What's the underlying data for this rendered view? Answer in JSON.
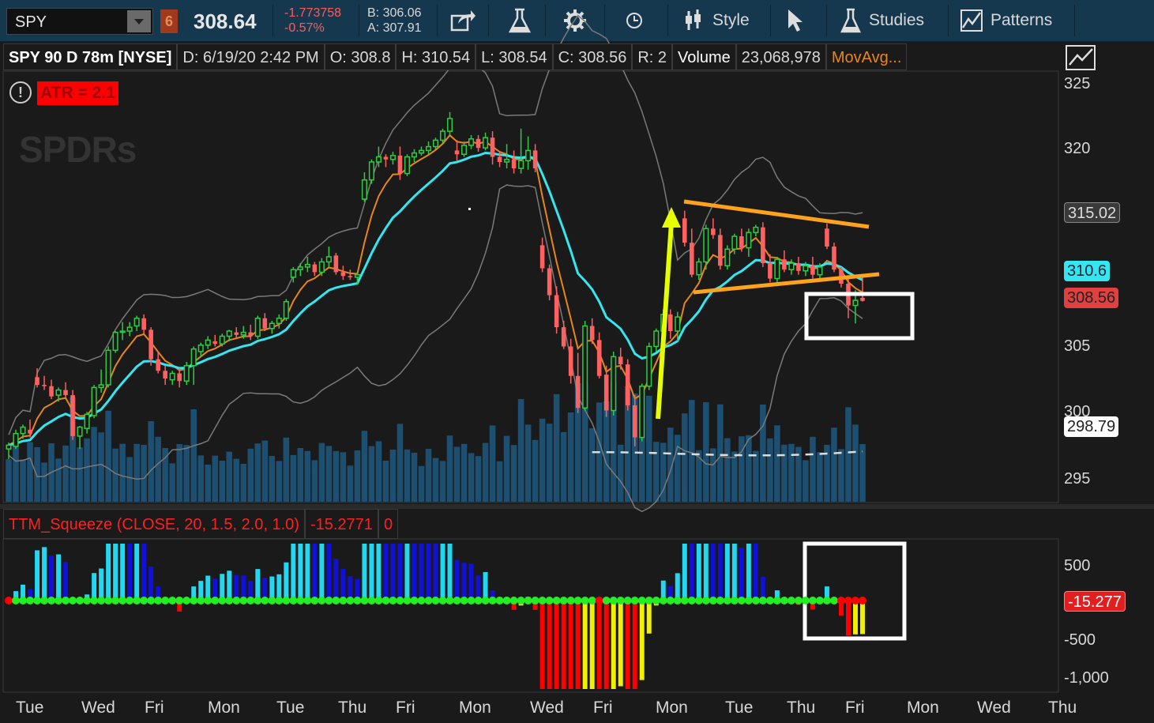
{
  "toolbar": {
    "symbol": "SPY",
    "link_badge": "6",
    "last": "308.64",
    "net_change": "-1.773758",
    "pct_change": "-0.57%",
    "bid": "B: 306.06",
    "ask": "A: 307.91",
    "style_label": "Style",
    "studies_label": "Studies",
    "patterns_label": "Patterns"
  },
  "header": {
    "title": "SPY 90 D 78m [NYSE]",
    "date": "D: 6/19/20 2:42 PM",
    "open": "O: 308.8",
    "high": "H: 310.54",
    "low": "L: 308.54",
    "close": "C: 308.56",
    "range": "R: 2",
    "volume_label": "Volume",
    "volume_value": "23,068,978",
    "movavg": "MovAvg..."
  },
  "annotations": {
    "atr": "ATR = 2.1",
    "logo": "SPDRs"
  },
  "price_axis": {
    "ticks": [
      "325",
      "320",
      "305",
      "300",
      "295"
    ],
    "labels": {
      "p315": "315.02",
      "p310": "310.6",
      "p308": "308.56",
      "p298": "298.79"
    }
  },
  "ttm": {
    "name": "TTM_Squeeze (CLOSE, 20, 1.5, 2.0, 1.0)",
    "value": "-15.2771",
    "zero": "0",
    "ticks": [
      "500",
      "-500",
      "-1,000"
    ],
    "current": "-15.277"
  },
  "time_axis": [
    "Tue",
    "Wed",
    "Fri",
    "Mon",
    "Tue",
    "Thu",
    "Fri",
    "Mon",
    "Wed",
    "Fri",
    "Mon",
    "Tue",
    "Thu",
    "Fri",
    "Mon",
    "Wed",
    "Thu"
  ],
  "colors": {
    "up": "#2ecc40",
    "down": "#ff6060",
    "ema_fast": "#e8861a",
    "ema_slow": "#33e6f0",
    "bollinger": "#7a7a7a",
    "volume": "#1d4f70",
    "trendline": "#ffa21c",
    "arrow": "#e6ff00",
    "hist_up_strong": "#22d8f0",
    "hist_up_weak": "#1010d8",
    "hist_down_strong": "#ff0000",
    "hist_down_weak": "#f0f000",
    "squeeze_on": "#ff0000",
    "squeeze_off": "#22ee22"
  },
  "chart_data": {
    "type": "candlestick",
    "title": "SPY 90 D 78m [NYSE]",
    "y_range": [
      293,
      326
    ],
    "candles": [
      [
        297,
        297.5,
        296.2,
        297.3
      ],
      [
        297.2,
        298.5,
        297,
        298.2
      ],
      [
        298.2,
        298.9,
        297.8,
        298.7
      ],
      [
        298.5,
        299.3,
        297.9,
        298.2
      ],
      [
        302.6,
        303.3,
        301.8,
        302.0
      ],
      [
        302,
        302.7,
        301.6,
        301.9
      ],
      [
        301.9,
        302.4,
        300.9,
        301.1
      ],
      [
        301.2,
        301.8,
        300.7,
        301.6
      ],
      [
        301.6,
        302.2,
        301.0,
        301.2
      ],
      [
        301.2,
        301.6,
        297.7,
        298.0
      ],
      [
        298,
        298.8,
        297.0,
        298.7
      ],
      [
        298.6,
        299.9,
        298.2,
        299.7
      ],
      [
        299.6,
        302.0,
        299.4,
        301.8
      ],
      [
        301.8,
        303.2,
        301.4,
        302.0
      ],
      [
        302,
        305.0,
        301.8,
        304.7
      ],
      [
        304.7,
        306.2,
        304.5,
        306.1
      ],
      [
        306.1,
        306.9,
        305.5,
        306.2
      ],
      [
        306.2,
        306.9,
        305.8,
        306.5
      ],
      [
        306.6,
        307.4,
        306.2,
        307.2
      ],
      [
        307.2,
        307.5,
        306.0,
        306.3
      ],
      [
        306.3,
        306.5,
        303.5,
        304.0
      ],
      [
        304,
        304.6,
        302.9,
        303.1
      ],
      [
        303.1,
        303.5,
        302.0,
        302.5
      ],
      [
        302.4,
        303.1,
        302.0,
        302.9
      ],
      [
        302.9,
        303.3,
        301.8,
        302.3
      ],
      [
        302.3,
        303.8,
        302.0,
        303.5
      ],
      [
        303.5,
        305.0,
        302.0,
        304.8
      ],
      [
        304.6,
        305.3,
        304.2,
        305.1
      ],
      [
        305.1,
        305.8,
        304.8,
        305.5
      ],
      [
        305.4,
        305.9,
        305.0,
        305.2
      ],
      [
        305.2,
        306.0,
        305.0,
        305.8
      ],
      [
        305.8,
        306.3,
        305.4,
        306.2
      ],
      [
        306.1,
        306.5,
        305.6,
        305.9
      ],
      [
        305.9,
        306.6,
        305.6,
        306.1
      ],
      [
        306.1,
        306.7,
        305.5,
        305.8
      ],
      [
        305.8,
        307.4,
        305.6,
        307.2
      ],
      [
        307.2,
        307.6,
        306.2,
        306.4
      ],
      [
        306.4,
        307.0,
        306.0,
        306.8
      ],
      [
        306.8,
        307.5,
        306.4,
        307.2
      ],
      [
        307.2,
        308.7,
        307.0,
        308.5
      ],
      [
        310.4,
        311.2,
        310.0,
        311.0
      ],
      [
        311,
        311.5,
        310.5,
        311.2
      ],
      [
        311.2,
        312.0,
        310.8,
        311.4
      ],
      [
        311.4,
        311.6,
        310.5,
        310.8
      ],
      [
        310.8,
        311.9,
        310.5,
        311.6
      ],
      [
        311.6,
        312.8,
        311.2,
        312.0
      ],
      [
        312.1,
        312.3,
        310.6,
        310.8
      ],
      [
        310.8,
        311.3,
        310.2,
        310.5
      ],
      [
        310.5,
        311.0,
        310.2,
        310.4
      ],
      [
        310.4,
        310.8,
        309.8,
        310.6
      ],
      [
        316.5,
        318.6,
        316.3,
        318.0
      ],
      [
        318,
        319.6,
        317.7,
        319.4
      ],
      [
        319.4,
        320.6,
        319.0,
        319.8
      ],
      [
        319.8,
        320.0,
        319.0,
        319.6
      ],
      [
        319.6,
        320.2,
        319.2,
        319.9
      ],
      [
        319.9,
        320.6,
        318.0,
        318.5
      ],
      [
        318.5,
        320.0,
        318.3,
        319.8
      ],
      [
        319.8,
        320.4,
        319.4,
        320.1
      ],
      [
        320.1,
        320.6,
        319.9,
        320.3
      ],
      [
        320.3,
        321.0,
        320.0,
        320.6
      ],
      [
        320.6,
        321.3,
        320.4,
        321.1
      ],
      [
        321.1,
        322.0,
        320.9,
        321.8
      ],
      [
        321.8,
        323.3,
        321.5,
        322.8
      ],
      [
        320.3,
        321.1,
        319.5,
        320.0
      ],
      [
        320,
        321.0,
        319.8,
        320.7
      ],
      [
        320.7,
        321.5,
        320.4,
        321.2
      ],
      [
        321.2,
        321.5,
        320.2,
        320.5
      ],
      [
        320.5,
        321.7,
        320.3,
        321.3
      ],
      [
        321.3,
        321.8,
        319.2,
        319.8
      ],
      [
        319.8,
        320.2,
        319.0,
        319.4
      ],
      [
        319.4,
        320.8,
        318.9,
        319.6
      ],
      [
        319.6,
        320.3,
        318.5,
        318.9
      ],
      [
        318.9,
        322.0,
        318.5,
        319.5
      ],
      [
        319.5,
        321.4,
        318.8,
        320.3
      ],
      [
        320.3,
        320.8,
        318.6,
        318.9
      ],
      [
        312.9,
        313.5,
        310.8,
        311.1
      ],
      [
        311.1,
        311.4,
        308.6,
        309.0
      ],
      [
        309,
        309.7,
        306.0,
        306.5
      ],
      [
        306.5,
        307.0,
        304.8,
        305.0
      ],
      [
        305,
        305.6,
        302.1,
        302.7
      ],
      [
        302.7,
        304.5,
        299.8,
        300.2
      ],
      [
        300.2,
        307.0,
        300.0,
        306.6
      ],
      [
        306.6,
        307.2,
        305.2,
        305.5
      ],
      [
        305.5,
        306.1,
        302.5,
        302.7
      ],
      [
        302.8,
        303.5,
        299.5,
        300.0
      ],
      [
        300,
        304.6,
        299.6,
        304.2
      ],
      [
        304.2,
        304.9,
        303.2,
        303.6
      ],
      [
        303.6,
        304.0,
        300.0,
        300.4
      ],
      [
        300.4,
        301.2,
        297.2,
        297.9
      ],
      [
        297.9,
        302.1,
        297.6,
        301.9
      ],
      [
        301.9,
        305.3,
        301.6,
        305.0
      ],
      [
        305,
        306.4,
        304.6,
        306.2
      ],
      [
        306.2,
        307.9,
        305.8,
        307.5
      ],
      [
        307.5,
        307.9,
        305.6,
        306.2
      ],
      [
        306.2,
        307.7,
        305.4,
        307.3
      ],
      [
        315.0,
        315.6,
        312.8,
        313.1
      ],
      [
        313.1,
        314.2,
        310.4,
        310.6
      ],
      [
        310.6,
        311.9,
        310.2,
        311.6
      ],
      [
        311.6,
        314.5,
        311.0,
        314.2
      ],
      [
        314.2,
        315.0,
        313.4,
        313.7
      ],
      [
        313.7,
        314.2,
        311.0,
        311.3
      ],
      [
        311.3,
        312.9,
        311.0,
        312.6
      ],
      [
        312.6,
        313.8,
        312.2,
        313.6
      ],
      [
        313.6,
        314.2,
        312.4,
        312.7
      ],
      [
        312.7,
        314.2,
        312.0,
        313.9
      ],
      [
        313.9,
        314.5,
        313.6,
        314.3
      ],
      [
        314.3,
        314.7,
        311.2,
        311.5
      ],
      [
        311.5,
        312.2,
        310.0,
        310.3
      ],
      [
        310.3,
        312.0,
        309.7,
        311.8
      ],
      [
        311.8,
        312.5,
        310.8,
        311.0
      ],
      [
        311,
        311.8,
        310.6,
        311.5
      ],
      [
        311.5,
        312.0,
        310.6,
        310.9
      ],
      [
        310.9,
        311.6,
        310.5,
        311.3
      ],
      [
        311.3,
        312.0,
        310.3,
        310.6
      ],
      [
        310.6,
        311.5,
        310.2,
        311.2
      ],
      [
        314.2,
        314.6,
        312.6,
        312.8
      ],
      [
        312.8,
        313.1,
        310.8,
        311.0
      ],
      [
        311,
        311.2,
        309.6,
        309.9
      ],
      [
        309.9,
        310.3,
        307.2,
        308.2
      ],
      [
        308.2,
        309.4,
        306.8,
        308.6
      ],
      [
        308.8,
        310.5,
        308.5,
        308.56
      ]
    ]
  }
}
